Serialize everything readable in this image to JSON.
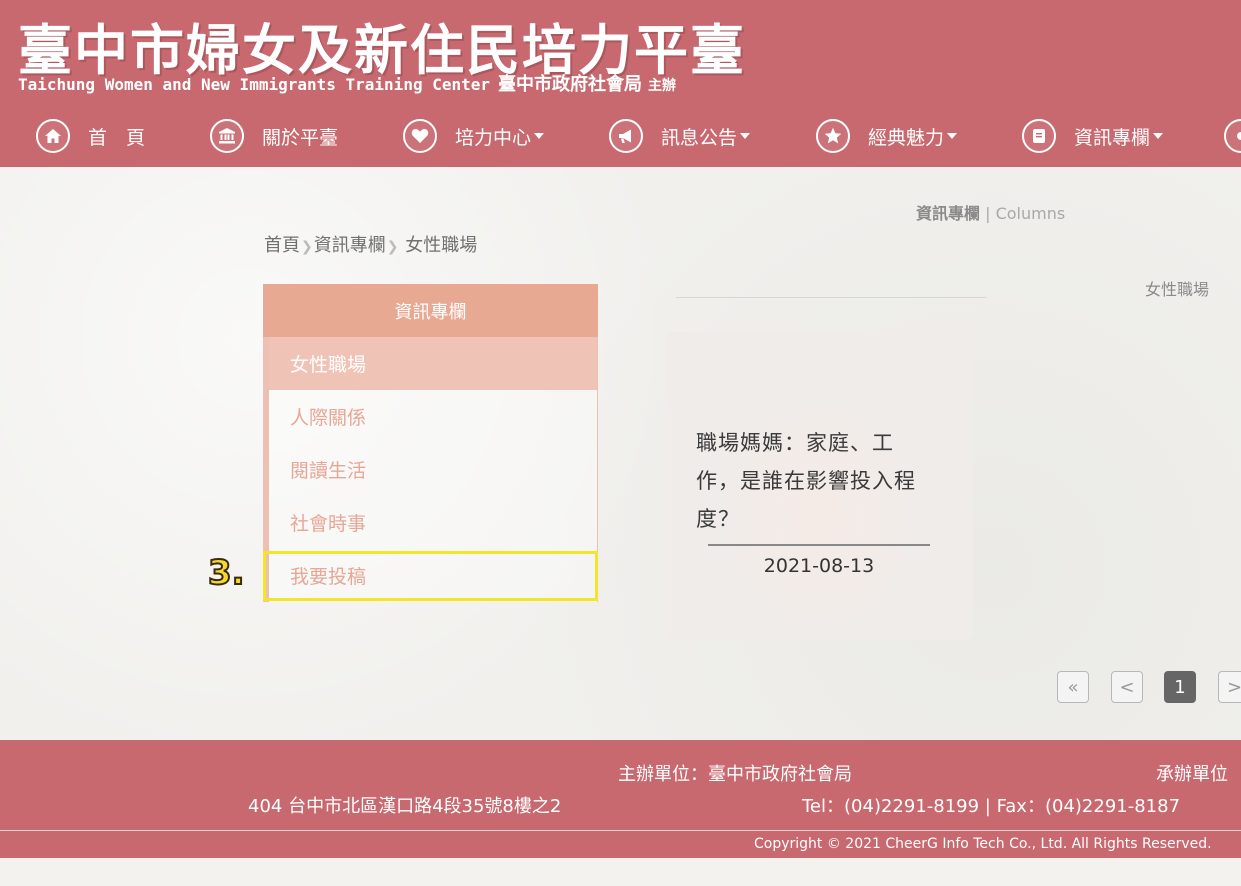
{
  "header": {
    "title": "臺中市婦女及新住民培力平臺",
    "subtitle_en": "Taichung Women and New Immigrants Training Center",
    "organizer": "臺中市政府社會局",
    "organizer_suffix": "主辦"
  },
  "nav": [
    {
      "label": "首　頁",
      "icon": "home-icon",
      "dropdown": false
    },
    {
      "label": "關於平臺",
      "icon": "institution-icon",
      "dropdown": false
    },
    {
      "label": "培力中心",
      "icon": "heart-icon",
      "dropdown": true
    },
    {
      "label": "訊息公告",
      "icon": "megaphone-icon",
      "dropdown": true
    },
    {
      "label": "經典魅力",
      "icon": "star-icon",
      "dropdown": true
    },
    {
      "label": "資訊專欄",
      "icon": "book-icon",
      "dropdown": true
    }
  ],
  "section": {
    "title": "資訊專欄",
    "separator": "|",
    "title_en": "Columns"
  },
  "breadcrumb": {
    "home": "首頁",
    "level1": "資訊專欄",
    "level2": "女性職場"
  },
  "right_label": "女性職場",
  "sidebar": {
    "heading": "資訊專欄",
    "items": [
      {
        "label": "女性職場",
        "active": true
      },
      {
        "label": "人際關係",
        "active": false
      },
      {
        "label": "閱讀生活",
        "active": false
      },
      {
        "label": "社會時事",
        "active": false
      },
      {
        "label": "我要投稿",
        "active": false
      }
    ]
  },
  "annotation": {
    "step_label": "3.",
    "color": "#f2e52a"
  },
  "articles": [
    {
      "title": "職場媽媽：家庭、工作，是誰在影響投入程度？",
      "date": "2021-08-13"
    }
  ],
  "pagination": {
    "first": "«",
    "prev": "<",
    "current": "1",
    "next": ">"
  },
  "footer": {
    "organizer": "主辦單位：臺中市政府社會局",
    "contractor": "承辦單位",
    "address": "404 台中市北區漢口路4段35號8樓之2",
    "contact": "Tel：(04)2291-8199 | Fax：(04)2291-8187",
    "copyright": "Copyright © 2021 CheerG Info Tech Co., Ltd. All Rights Reserved."
  },
  "colors": {
    "brand": "#c8686f",
    "sidebar_head": "#e8a993",
    "sidebar_active": "#efc3b5",
    "sidebar_text": "#e7a796"
  }
}
